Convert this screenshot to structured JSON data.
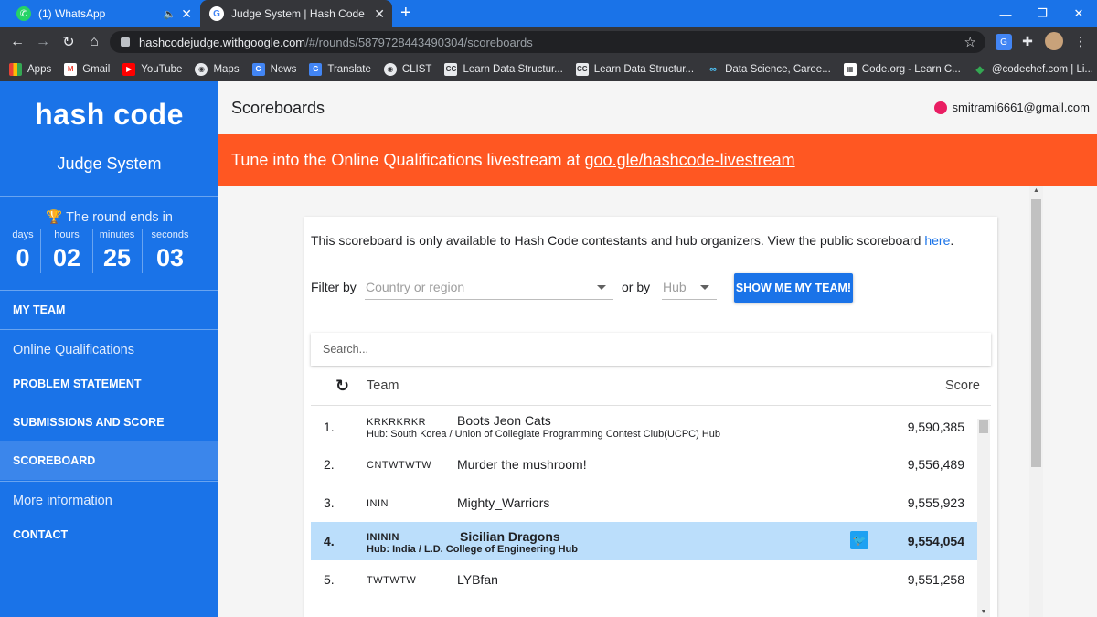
{
  "browser": {
    "tabs": [
      {
        "title": "(1) WhatsApp",
        "favicon": "whatsapp-icon"
      },
      {
        "title": "Judge System | Hash Code",
        "favicon": "google-icon"
      }
    ],
    "url_host": "hashcodejudge.withgoogle.com",
    "url_path": "/#/rounds/5879728443490304/scoreboards",
    "bookmarks": [
      "Apps",
      "Gmail",
      "YouTube",
      "Maps",
      "News",
      "Translate",
      "CLIST",
      "Learn Data Structur...",
      "Learn Data Structur...",
      "Data Science, Caree...",
      "Code.org - Learn C...",
      "@codechef.com | Li..."
    ]
  },
  "sidebar": {
    "logo": "hash code",
    "subtitle": "Judge System",
    "round_ends": "The round ends in",
    "countdown": [
      {
        "label": "days",
        "value": "0"
      },
      {
        "label": "hours",
        "value": "02"
      },
      {
        "label": "minutes",
        "value": "25"
      },
      {
        "label": "seconds",
        "value": "03"
      }
    ],
    "my_team": "MY TEAM",
    "online_qualifications": "Online Qualifications",
    "problem_statement": "PROBLEM STATEMENT",
    "submissions": "SUBMISSIONS AND SCORE",
    "scoreboard": "SCOREBOARD",
    "more_info": "More information",
    "contact": "CONTACT"
  },
  "header": {
    "title": "Scoreboards",
    "user_email": "smitrami6661@gmail.com"
  },
  "banner": {
    "text": "Tune into the Online Qualifications livestream at",
    "link": "goo.gle/hashcode-livestream",
    "color": "#ff5722"
  },
  "scoreboard": {
    "info_text": "This scoreboard is only available to Hash Code contestants and hub organizers. View the public scoreboard",
    "info_link": "here",
    "info_end": ".",
    "filter_by": "Filter by",
    "country_placeholder": "Country or region",
    "or_by": "or by",
    "hub_placeholder": "Hub",
    "show_team_button": "SHOW ME MY TEAM!",
    "search_placeholder": "Search...",
    "col_team": "Team",
    "col_score": "Score",
    "rows": [
      {
        "rank": "1.",
        "tag": "KRKRKRKR",
        "name": "Boots Jeon Cats",
        "hub": "Hub: South Korea / Union of Collegiate Programming Contest Club(UCPC) Hub",
        "score": "9,590,385"
      },
      {
        "rank": "2.",
        "tag": "CNTWTWTW",
        "name": "Murder the mushroom!",
        "hub": "",
        "score": "9,556,489"
      },
      {
        "rank": "3.",
        "tag": "ININ",
        "name": "Mighty_Warriors",
        "hub": "",
        "score": "9,555,923"
      },
      {
        "rank": "4.",
        "tag": "INININ",
        "name": "Sicilian Dragons",
        "hub": "Hub: India / L.D. College of Engineering Hub",
        "score": "9,554,054"
      },
      {
        "rank": "5.",
        "tag": "TWTWTW",
        "name": "LYBfan",
        "hub": "",
        "score": "9,551,258"
      }
    ],
    "highlight_color": "#bbdefb"
  },
  "colors": {
    "brand_blue": "#1a73e8",
    "banner_orange": "#ff5722",
    "twitter_blue": "#1da1f2"
  }
}
